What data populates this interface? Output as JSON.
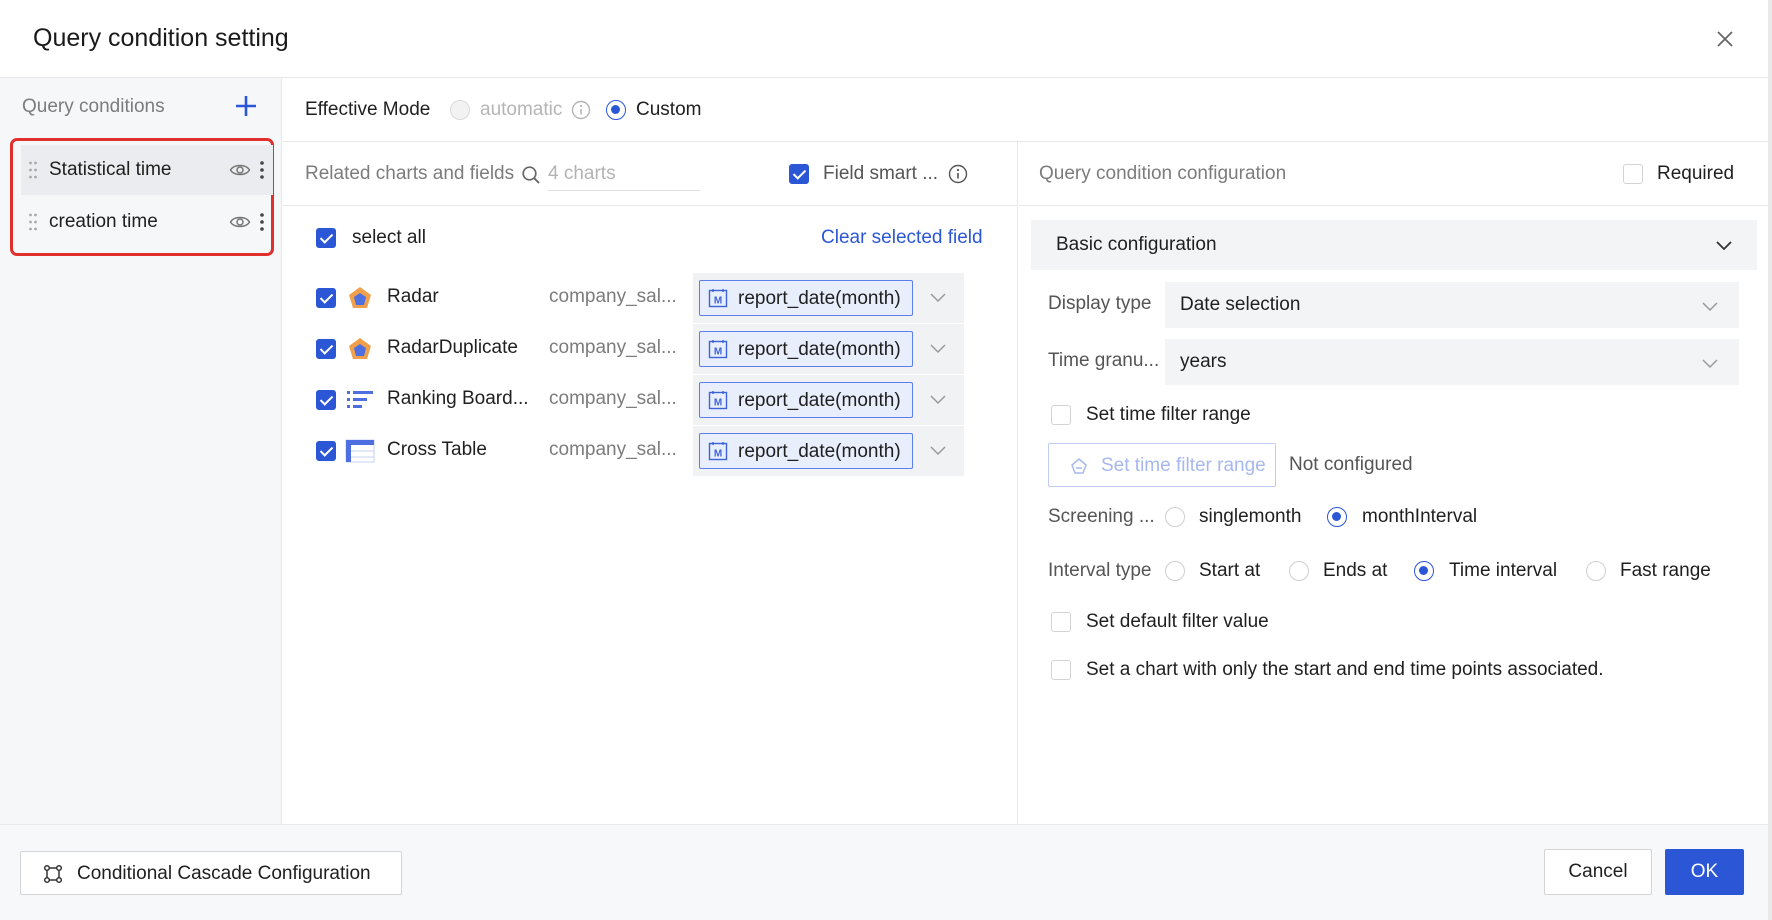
{
  "dialog": {
    "title": "Query condition setting"
  },
  "sidebar": {
    "header": "Query conditions",
    "items": [
      {
        "label": "Statistical time"
      },
      {
        "label": "creation time"
      }
    ]
  },
  "mode": {
    "label": "Effective Mode",
    "options": [
      {
        "label": "automatic",
        "disabled": true
      },
      {
        "label": "Custom",
        "selected": true
      }
    ]
  },
  "middle": {
    "header": "Related charts and fields",
    "search_placeholder": "4 charts",
    "field_smart_label": "Field smart ...",
    "select_all_label": "select all",
    "clear_link": "Clear selected field",
    "charts": [
      {
        "name": "Radar",
        "icon": "radar-chart-icon",
        "dataset": "company_sal...",
        "field": "report_date(month)"
      },
      {
        "name": "RadarDuplicate",
        "icon": "radar-chart-icon",
        "dataset": "company_sal...",
        "field": "report_date(month)"
      },
      {
        "name": "Ranking Board...",
        "icon": "ranking-board-icon",
        "dataset": "company_sal...",
        "field": "report_date(month)"
      },
      {
        "name": "Cross Table",
        "icon": "cross-table-icon",
        "dataset": "company_sal...",
        "field": "report_date(month)"
      }
    ]
  },
  "right": {
    "header": "Query condition configuration",
    "required_label": "Required",
    "section_title": "Basic configuration",
    "display_type": {
      "label": "Display type",
      "value": "Date selection"
    },
    "time_granularity": {
      "label": "Time granu...",
      "value": "years"
    },
    "set_range_checkbox": "Set time filter range",
    "set_range_button": "Set time filter range",
    "not_configured": "Not configured",
    "screening": {
      "label": "Screening ...",
      "options": [
        {
          "label": "singlemonth",
          "selected": false
        },
        {
          "label": "monthInterval",
          "selected": true
        }
      ]
    },
    "interval_type": {
      "label": "Interval type",
      "options": [
        {
          "label": "Start at",
          "selected": false
        },
        {
          "label": "Ends at",
          "selected": false
        },
        {
          "label": "Time interval",
          "selected": true
        },
        {
          "label": "Fast range",
          "selected": false
        }
      ]
    },
    "default_filter_checkbox": "Set default filter value",
    "start_end_checkbox": "Set a chart with only the start and end time points associated."
  },
  "footer": {
    "cascade_button": "Conditional Cascade Configuration",
    "cancel_button": "Cancel",
    "ok_button": "OK"
  },
  "colors": {
    "primary": "#2b56d6",
    "highlight_border": "#e0302b",
    "field_tag_bg": "#e8eefc"
  }
}
